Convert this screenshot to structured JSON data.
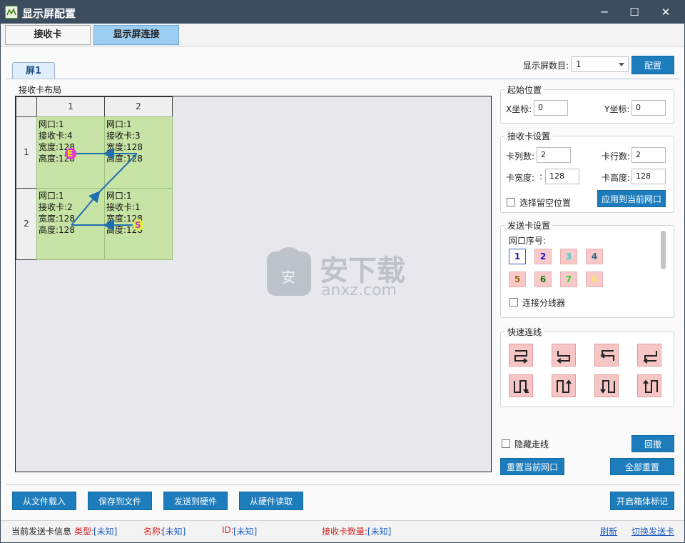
{
  "window": {
    "title": "显示屏配置",
    "controls": {
      "minimize": "─",
      "maximize": "☐",
      "close": "✕"
    }
  },
  "top_tabs": [
    {
      "label": "接收卡",
      "active": false
    },
    {
      "label": "显示屏连接",
      "active": true
    }
  ],
  "screen_tab": "屏1",
  "screen_count": {
    "label": "显示屏数目:",
    "value": "1",
    "config_button": "配置"
  },
  "layout": {
    "group_title": "接收卡布局",
    "col_headers": [
      "1",
      "2"
    ],
    "row_headers": [
      "1",
      "2"
    ],
    "cells": [
      {
        "port": "网口:1",
        "card": "接收卡:4",
        "width": "宽度:128",
        "height": "高度:128"
      },
      {
        "port": "网口:1",
        "card": "接收卡:3",
        "width": "宽度:128",
        "height": "高度:128"
      },
      {
        "port": "网口:1",
        "card": "接收卡:2",
        "width": "宽度:128",
        "height": "高度:128"
      },
      {
        "port": "网口:1",
        "card": "接收卡:1",
        "width": "宽度:128",
        "height": "高度:128"
      }
    ],
    "end_marker": "E",
    "start_marker": "S"
  },
  "start_position": {
    "title": "起始位置",
    "x_label": "X坐标:",
    "x_value": "0",
    "y_label": "Y坐标:",
    "y_value": "0"
  },
  "card_settings": {
    "title": "接收卡设置",
    "cols_label": "卡列数:",
    "cols_value": "2",
    "rows_label": "卡行数:",
    "rows_value": "2",
    "width_label": "卡宽度:",
    "width_colon": ":",
    "width_value": "128",
    "height_label": "卡高度:",
    "height_value": "128",
    "reserve_label": "选择留空位置",
    "apply_button": "应用到当前网口"
  },
  "sender_settings": {
    "title": "发送卡设置",
    "port_label": "网口序号:",
    "ports": [
      {
        "n": "1",
        "color": "#1a2a8a"
      },
      {
        "n": "2",
        "color": "#1414d8"
      },
      {
        "n": "3",
        "color": "#25d4d4"
      },
      {
        "n": "4",
        "color": "#2a6a8a"
      },
      {
        "n": "5",
        "color": "#9a6a10"
      },
      {
        "n": "6",
        "color": "#0a7a0a"
      },
      {
        "n": "7",
        "color": "#28d428"
      },
      {
        "n": "8",
        "color": "#f4e860"
      }
    ],
    "splitter_label": "连接分线器"
  },
  "quick_connect": {
    "title": "快速连线"
  },
  "hide_routing_label": "隐藏走线",
  "undo_button": "回撤",
  "reset_port_button": "重置当前网口",
  "reset_all_button": "全部重置",
  "bottom_buttons": [
    "从文件载入",
    "保存到文件",
    "发送到硬件",
    "从硬件读取"
  ],
  "cabinet_button": "开启箱体标记",
  "status": {
    "label": "当前发送卡信息",
    "type": "类型:",
    "type_value": "[未知]",
    "name": "名称:",
    "name_value": "[未知]",
    "id": "ID:",
    "id_value": "[未知]",
    "count": "接收卡数量:",
    "count_value": "[未知]",
    "refresh": "刷新",
    "switch": "切换发送卡"
  },
  "watermark": {
    "text_cn": "安下载",
    "text_en": "anxz.com"
  }
}
